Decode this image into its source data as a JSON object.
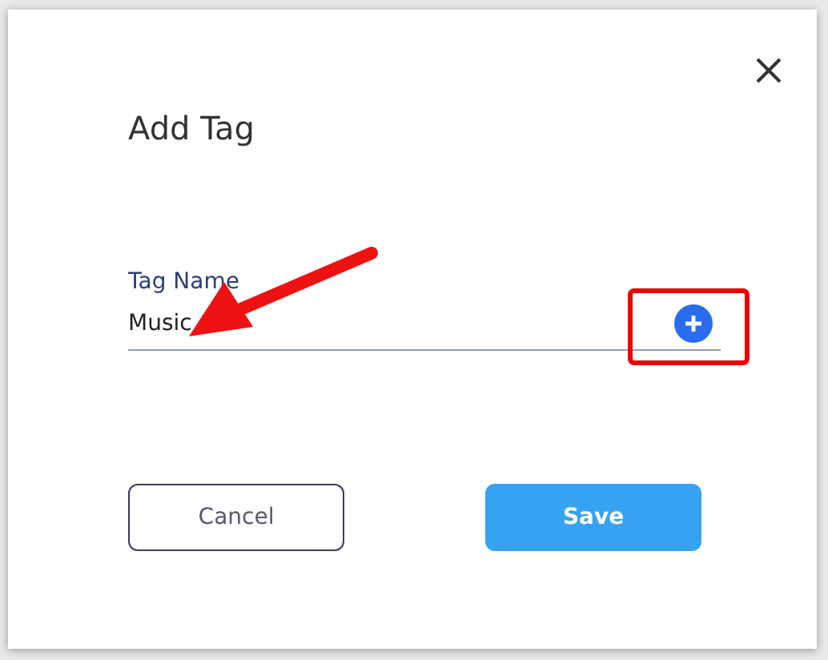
{
  "dialog": {
    "title": "Add Tag",
    "field": {
      "label": "Tag Name",
      "value": "Music"
    },
    "buttons": [
      {
        "label": "Cancel",
        "kind": "secondary"
      },
      {
        "label": "Save",
        "kind": "primary"
      }
    ]
  }
}
